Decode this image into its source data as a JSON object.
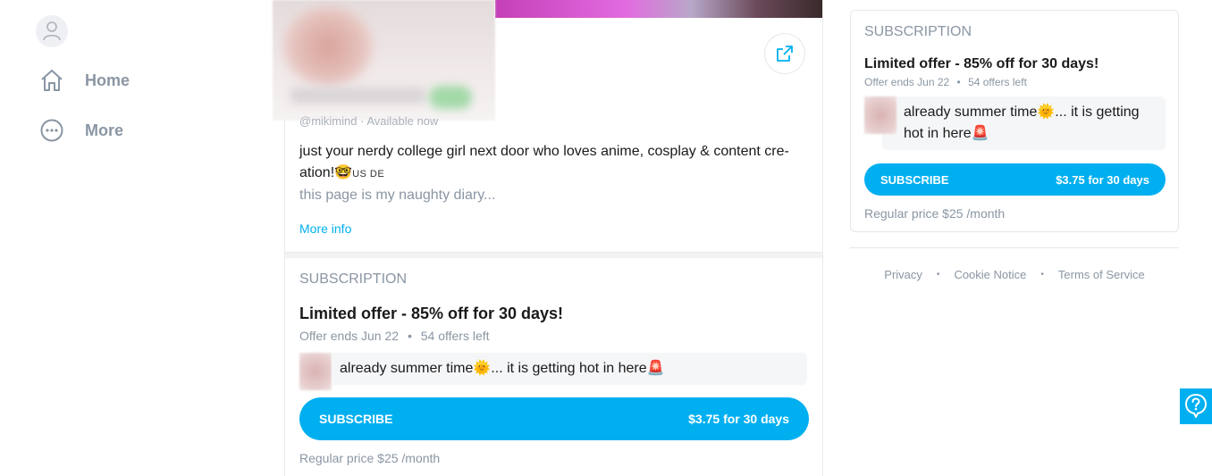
{
  "nav": {
    "items": [
      {
        "label": "Home",
        "icon": "home-icon"
      },
      {
        "label": "More",
        "icon": "more-circle-icon"
      }
    ]
  },
  "profile": {
    "handle": "@mikimind · Available now",
    "bio_line1": "just your nerdy college girl next door who loves anime, cosplay & content cre-",
    "bio_line2": "ation!🤓",
    "bio_flags": "US DE",
    "bio_line3": "this page is my naughty diary...",
    "more_info": "More info"
  },
  "subscription": {
    "section_title": "SUBSCRIPTION",
    "offer_title": "Limited offer - 85% off for 30 days!",
    "offer_ends": "Offer ends Jun 22",
    "offers_left": "54 offers left",
    "message": "already summer time🌞... it is getting hot in here🚨",
    "button_label": "SUBSCRIBE",
    "button_price": "$3.75 for 30 days",
    "regular_price": "Regular price $25 /month"
  },
  "sidebar_card": {
    "section_title": "SUBSCRIPTION",
    "offer_title": "Limited offer - 85% off for 30 days!",
    "offer_ends": "Offer ends Jun 22",
    "offers_left": "54 offers left",
    "message": "already summer time🌞... it is getting hot in here🚨",
    "button_label": "SUBSCRIBE",
    "button_price": "$3.75 for 30 days",
    "regular_price": "Regular price $25 /month"
  },
  "footer": {
    "privacy": "Privacy",
    "cookie": "Cookie Notice",
    "terms": "Terms of Service"
  },
  "colors": {
    "accent": "#00aff0",
    "muted": "#8a96a3"
  }
}
